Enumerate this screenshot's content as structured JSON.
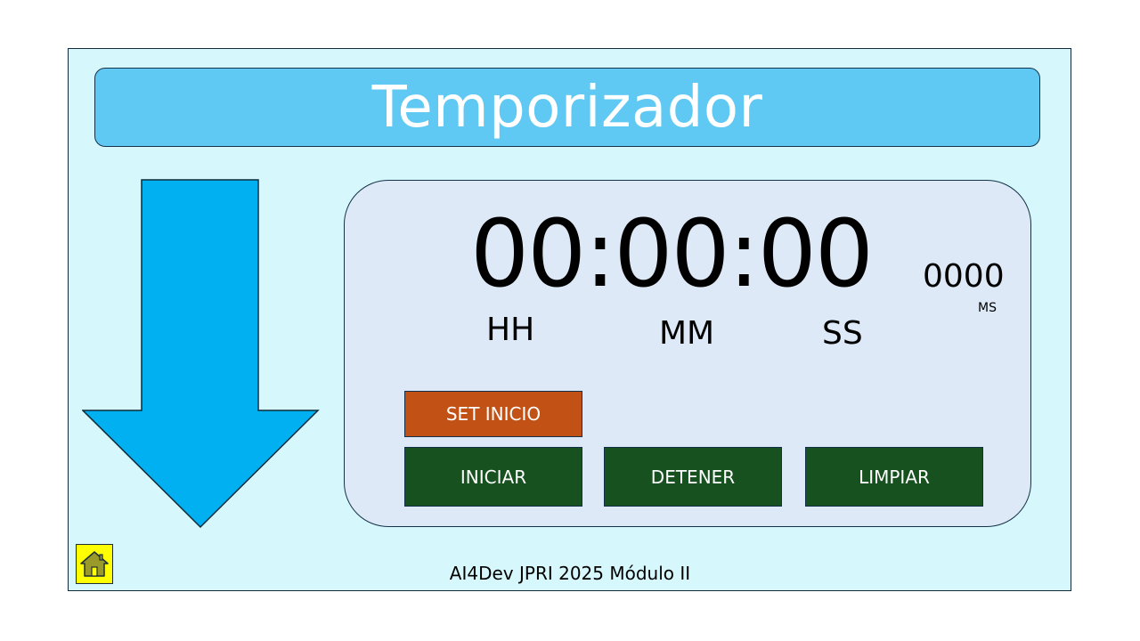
{
  "title": "Temporizador",
  "timer": {
    "display": "00:00:00",
    "milliseconds": "0000",
    "ms_label": "MS",
    "hours_label": "HH",
    "minutes_label": "MM",
    "seconds_label": "SS"
  },
  "buttons": {
    "set_start": "SET INICIO",
    "start": "INICIAR",
    "stop": "DETENER",
    "clear": "LIMPIAR"
  },
  "footer": "AI4Dev JPRI 2025 Módulo II",
  "icons": {
    "arrow": "arrow-down-icon",
    "home": "home-icon"
  },
  "colors": {
    "slide_bg": "#d6f7fb",
    "title_bg": "#5fc9f3",
    "arrow": "#00b0f0",
    "panel_bg": "#dde9f6",
    "btn_green": "#16511f",
    "btn_orange": "#c25115",
    "home_bg": "#ffff00"
  }
}
